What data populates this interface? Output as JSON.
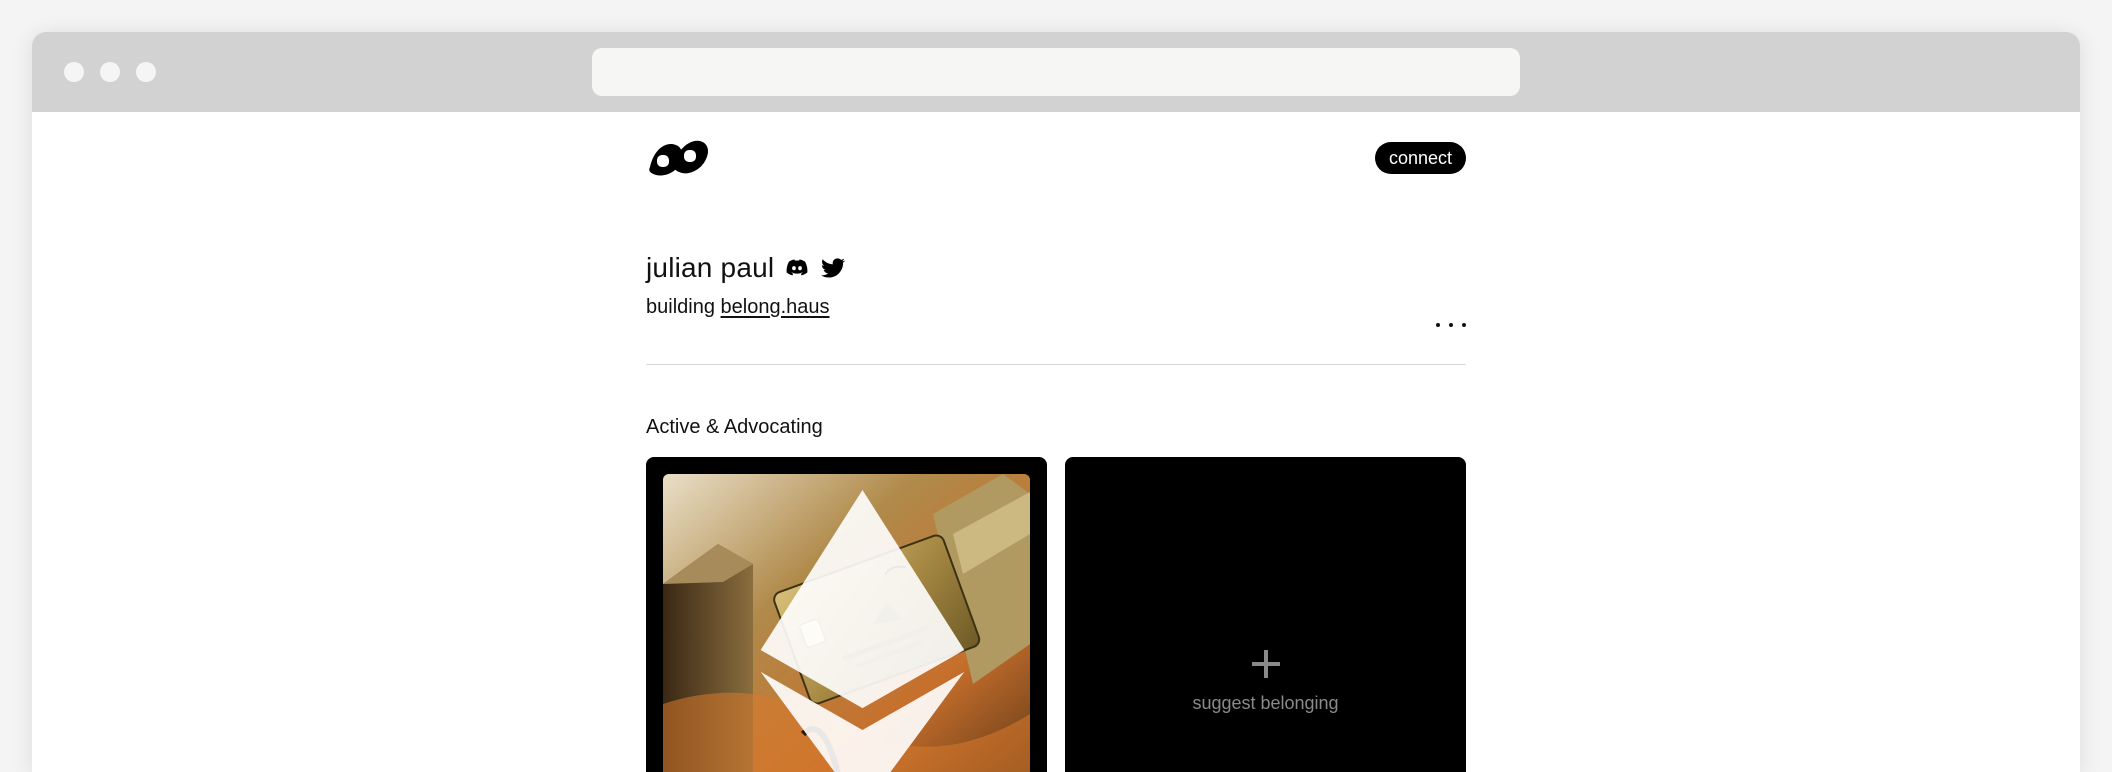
{
  "browser": {
    "address_bar": ""
  },
  "header": {
    "logo": "belong-logo-icon",
    "connect_label": "connect"
  },
  "profile": {
    "name": "julian paul",
    "social_icons": [
      "discord-icon",
      "twitter-icon"
    ],
    "bio_prefix": "building",
    "bio_link": "belong.haus",
    "more_menu": "more-dots-icon"
  },
  "section": {
    "title": "Active & Advocating"
  },
  "cards": [
    {
      "kind": "image",
      "icon": "ethereum-icon",
      "image": "gold-card-photo"
    },
    {
      "kind": "add",
      "icon": "plus-icon",
      "label": "suggest belonging"
    }
  ],
  "colors": {
    "chrome": "#d2d2d2",
    "card_background": "#000000",
    "button_background": "#000000",
    "muted_text": "#8a8a8a"
  }
}
